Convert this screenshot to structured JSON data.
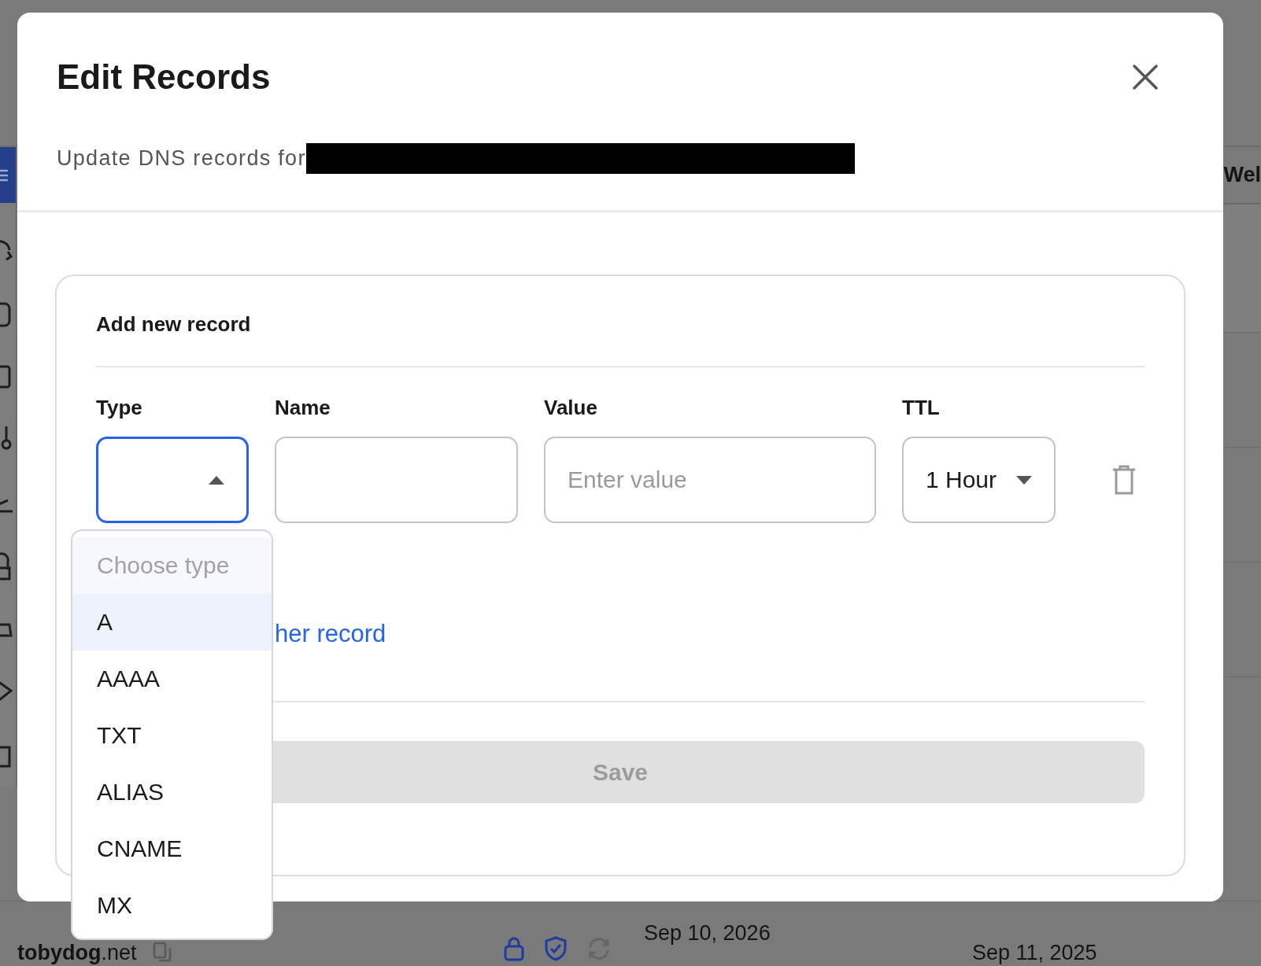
{
  "background": {
    "tab": "Wel",
    "sidebar": {
      "items": [
        {
          "selected": true
        },
        {
          "selected": false
        },
        {
          "selected": false
        },
        {
          "selected": false
        },
        {
          "selected": false
        },
        {
          "selected": false
        },
        {
          "selected": false
        },
        {
          "selected": false
        },
        {
          "selected": false
        },
        {
          "selected": false
        }
      ]
    },
    "row": {
      "domain": "**tobydog**.net",
      "date_1": "Sep 10, 2026",
      "date_2": "Sep 11, 2025"
    }
  },
  "dialog": {
    "title": "Edit Records",
    "subtitle": "Update DNS records for",
    "section_title": "Add new record",
    "fields": [
      {
        "kind": "select",
        "label": "Type",
        "focused": true,
        "expanded": true
      },
      {
        "kind": "text",
        "label": "Name",
        "focused": false
      },
      {
        "kind": "text",
        "label": "Value",
        "placeholder": "Enter value",
        "focused": false
      },
      {
        "kind": "select",
        "label": "TTL",
        "value": "1 Hour",
        "focused": false,
        "expanded": false
      }
    ],
    "add_link": "her record",
    "save_button": {
      "label": "Save",
      "disabled": true
    },
    "type_menu": {
      "placeholder": "Choose type",
      "options": [
        {
          "label": "A",
          "selected": true
        },
        {
          "label": "AAAA",
          "selected": false
        },
        {
          "label": "TXT",
          "selected": false
        },
        {
          "label": "ALIAS",
          "selected": false
        },
        {
          "label": "CNAME",
          "selected": false
        },
        {
          "label": "MX",
          "selected": false
        }
      ]
    }
  }
}
